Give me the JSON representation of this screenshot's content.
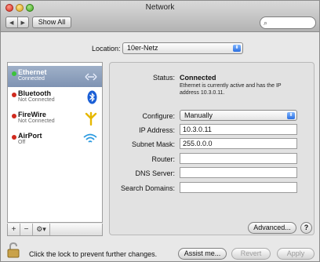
{
  "window": {
    "title": "Network"
  },
  "toolbar": {
    "back": "◀",
    "forward": "▶",
    "show_all": "Show All",
    "search_placeholder": ""
  },
  "location": {
    "label": "Location:",
    "value": "10er-Netz"
  },
  "services": [
    {
      "name": "Ethernet",
      "status": "Connected",
      "status_color": "#3cc33c",
      "icon": "ethernet-icon",
      "selected": true
    },
    {
      "name": "Bluetooth",
      "status": "Not Connected",
      "status_color": "#d02a1e",
      "icon": "bluetooth-icon",
      "selected": false
    },
    {
      "name": "FireWire",
      "status": "Not Connected",
      "status_color": "#d02a1e",
      "icon": "firewire-icon",
      "selected": false
    },
    {
      "name": "AirPort",
      "status": "Off",
      "status_color": "#d02a1e",
      "icon": "airport-icon",
      "selected": false
    }
  ],
  "sidebar_tools": {
    "add": "+",
    "remove": "−",
    "action": "⚙▾"
  },
  "details": {
    "status_label": "Status:",
    "status_value": "Connected",
    "status_description": "Ethernet is currently active and has the IP address 10.3.0.11.",
    "configure_label": "Configure:",
    "configure_value": "Manually",
    "ip_label": "IP Address:",
    "ip_value": "10.3.0.11",
    "subnet_label": "Subnet Mask:",
    "subnet_value": "255.0.0.0",
    "router_label": "Router:",
    "router_value": "",
    "dns_label": "DNS Server:",
    "dns_value": "",
    "search_domains_label": "Search Domains:",
    "search_domains_value": ""
  },
  "buttons": {
    "advanced": "Advanced...",
    "help": "?",
    "assist": "Assist me...",
    "revert": "Revert",
    "apply": "Apply"
  },
  "lock": {
    "text": "Click the lock to prevent further changes."
  }
}
